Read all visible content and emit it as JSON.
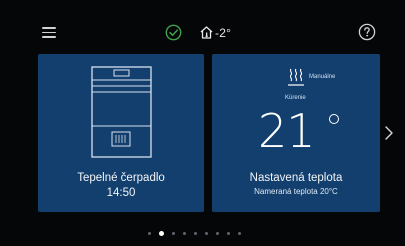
{
  "topbar": {
    "menu_icon": "hamburger-menu-icon",
    "status_icon": "check-circle-icon",
    "outside_temp": "-2°",
    "house_icon": "house-thermometer-icon",
    "help_icon": "help-question-icon"
  },
  "cards": {
    "heat_pump": {
      "icon": "heat-pump-illustration",
      "title": "Tepelné čerpadlo",
      "time": "14:50"
    },
    "temperature": {
      "heating_icon": "heating-waves-icon",
      "mode": "Manuálne",
      "heating_label": "Kúrenie",
      "value": "21",
      "degree_symbol_icon": "degree-circle",
      "title": "Nastavená teplota",
      "measured": "Nameraná teplota 20°C"
    }
  },
  "navigation": {
    "next_icon": "chevron-right-icon"
  },
  "pager": {
    "total": 9,
    "active_index": 1
  },
  "colors": {
    "background": "#050608",
    "card": "#133f6e",
    "accent_green": "#3fa24a"
  }
}
